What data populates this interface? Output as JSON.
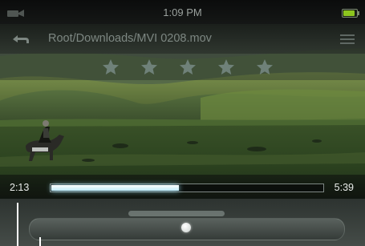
{
  "status_bar": {
    "time": "1:09 PM",
    "camera_icon": "camera-icon",
    "battery_icon": "battery-icon",
    "battery_level": 0.9,
    "battery_color": "#8dc61e"
  },
  "header": {
    "back_icon": "back-arrow-icon",
    "path": "Root/Downloads/MVI 0208.mov",
    "menu_icon": "menu-lines-icon"
  },
  "rating": {
    "max_stars": 5,
    "filled_stars": 0,
    "star_icon": "star-icon"
  },
  "playback": {
    "elapsed": "2:13",
    "total": "5:39",
    "progress": 0.47,
    "progress_color": "#bfeaf8"
  },
  "controls": {
    "volume_knob_icon": "slider-knob"
  }
}
